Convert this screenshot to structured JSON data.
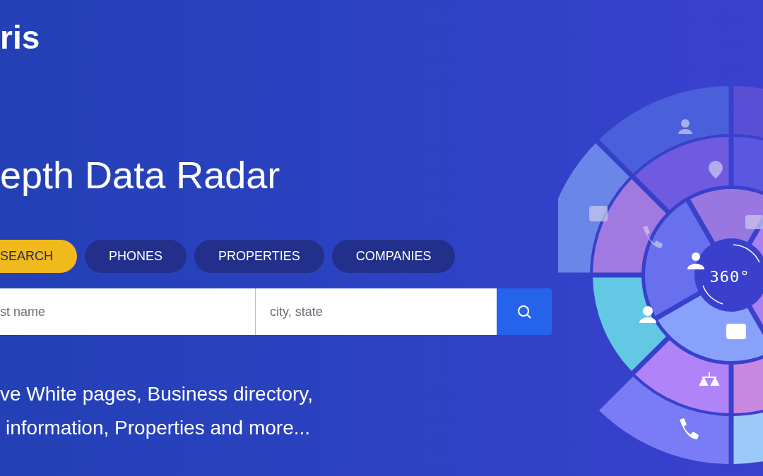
{
  "logo": {
    "text": "ris"
  },
  "headline": "epth Data Radar",
  "tabs": [
    {
      "label": "SEARCH",
      "selected": true
    },
    {
      "label": "PHONES",
      "selected": false
    },
    {
      "label": "PROPERTIES",
      "selected": false
    },
    {
      "label": "COMPANIES",
      "selected": false
    }
  ],
  "search": {
    "fields": [
      {
        "placeholder": "st name"
      },
      {
        "placeholder": "city, state"
      }
    ]
  },
  "description": [
    "ve White pages, Business directory,",
    "information, Properties and more..."
  ],
  "radar": {
    "label": "360°"
  }
}
